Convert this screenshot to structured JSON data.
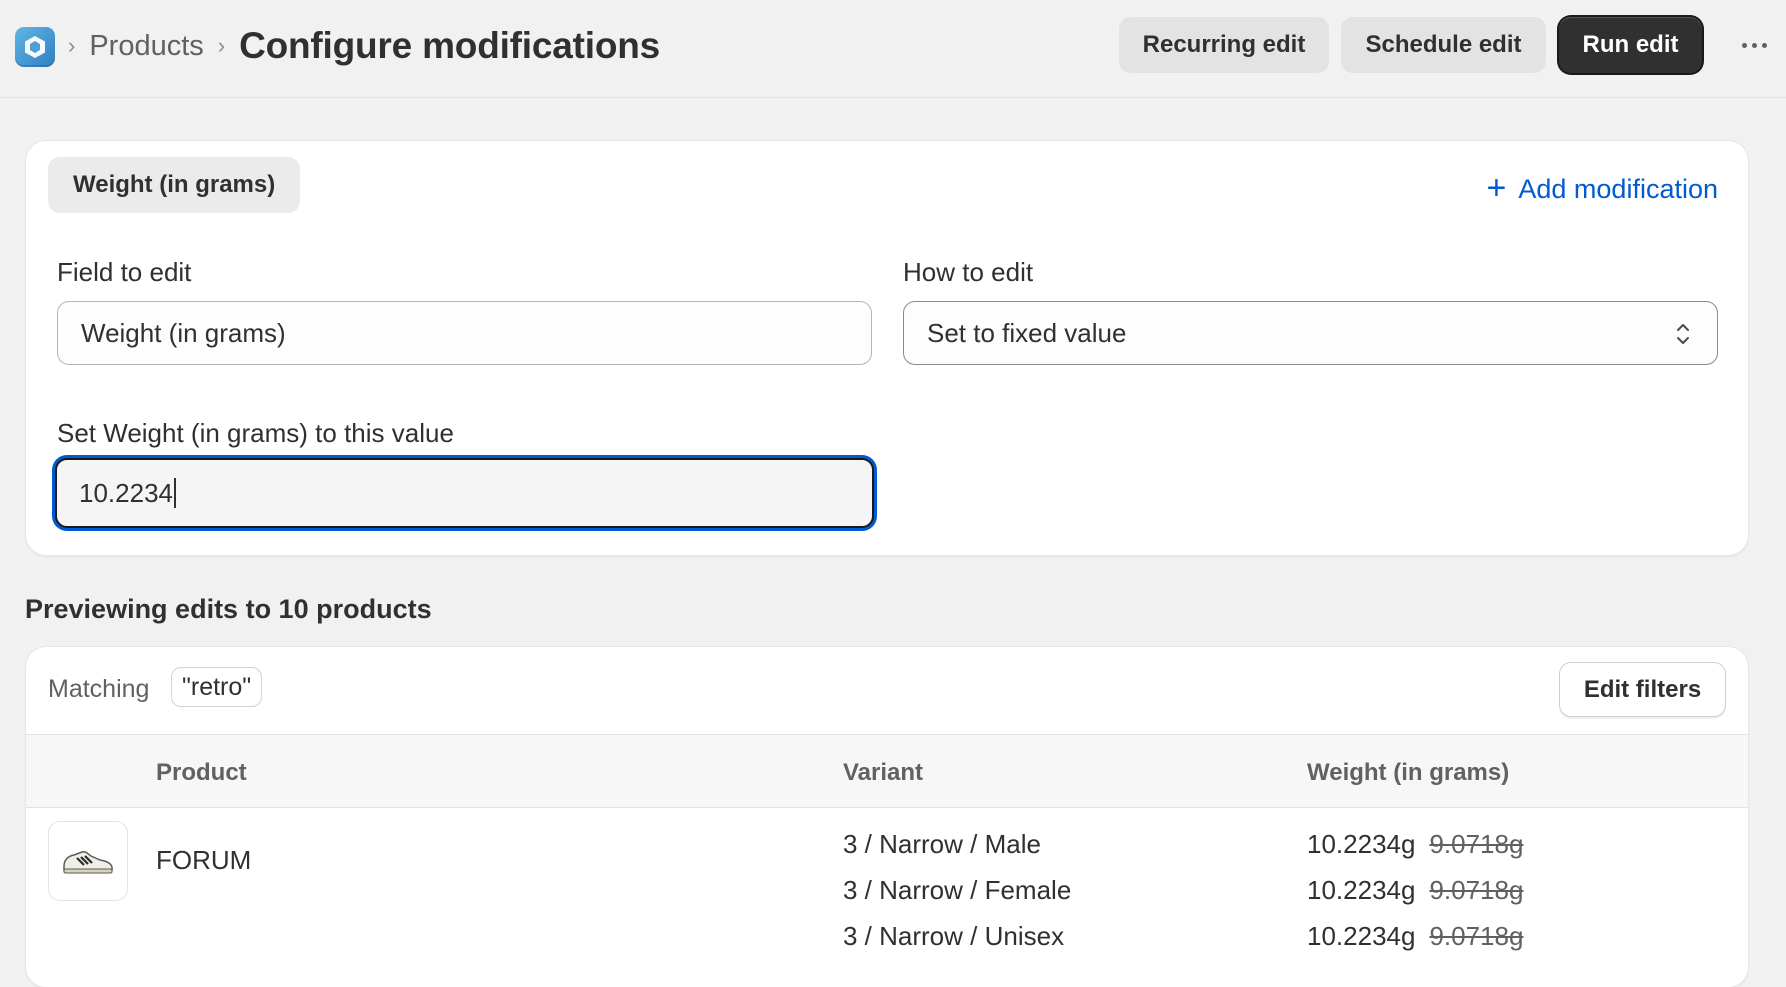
{
  "header": {
    "app_icon": "app-hexagon-icon",
    "breadcrumb_parent": "Products",
    "title": "Configure modifications",
    "buttons": {
      "recurring": "Recurring edit",
      "schedule": "Schedule edit",
      "run": "Run edit"
    },
    "more_icon": "more-horizontal-icon"
  },
  "modification": {
    "tab_label": "Weight (in grams)",
    "add_label": "Add modification",
    "field_to_edit_label": "Field to edit",
    "field_to_edit_value": "Weight (in grams)",
    "how_to_edit_label": "How to edit",
    "how_to_edit_value": "Set to fixed value",
    "set_value_label": "Set Weight (in grams) to this value",
    "set_value": "10.2234"
  },
  "preview": {
    "heading": "Previewing edits to 10 products",
    "matching_label": "Matching",
    "matching_query": "\"retro\"",
    "edit_filters": "Edit filters",
    "columns": {
      "product": "Product",
      "variant": "Variant",
      "weight": "Weight (in grams)"
    },
    "rows": [
      {
        "product": "FORUM",
        "variants": [
          {
            "name": "3 / Narrow / Male",
            "new_weight": "10.2234g",
            "old_weight": "9.0718g"
          },
          {
            "name": "3 / Narrow / Female",
            "new_weight": "10.2234g",
            "old_weight": "9.0718g"
          },
          {
            "name": "3 / Narrow / Unisex",
            "new_weight": "10.2234g",
            "old_weight": "9.0718g"
          }
        ]
      }
    ]
  },
  "colors": {
    "accent_link": "#005bd3",
    "primary_button": "#303030",
    "focus_ring": "#005bd3"
  }
}
